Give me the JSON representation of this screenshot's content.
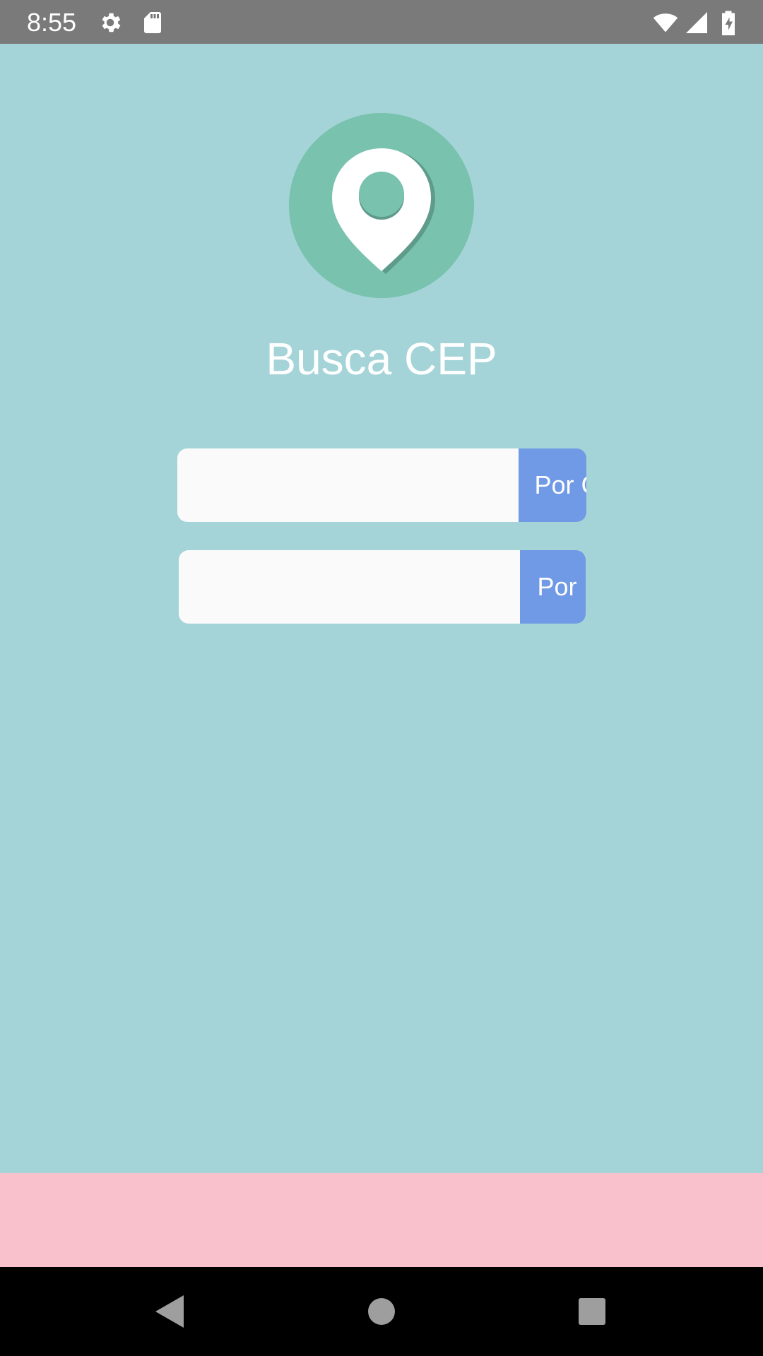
{
  "status_bar": {
    "time": "8:55",
    "icons": [
      "gear-icon",
      "sd-card-icon",
      "wifi-icon",
      "signal-icon",
      "battery-charging-icon"
    ]
  },
  "app": {
    "logo_icon": "location-pin-icon",
    "title": "Busca CEP"
  },
  "search_cep": {
    "value": "",
    "button_label": "Por CEP"
  },
  "search_rua": {
    "value": "",
    "button_label": "Por Rua"
  },
  "nav_bar": {
    "icons": [
      "back-icon",
      "home-icon",
      "recents-icon"
    ]
  },
  "colors": {
    "background": "#a5d4d8",
    "status_bar": "#7a7a7a",
    "logo_circle": "#78c2ae",
    "button": "#7099e6",
    "input": "#fafafa",
    "footer_banner": "#f9c1cc",
    "nav_bar": "#000000"
  }
}
